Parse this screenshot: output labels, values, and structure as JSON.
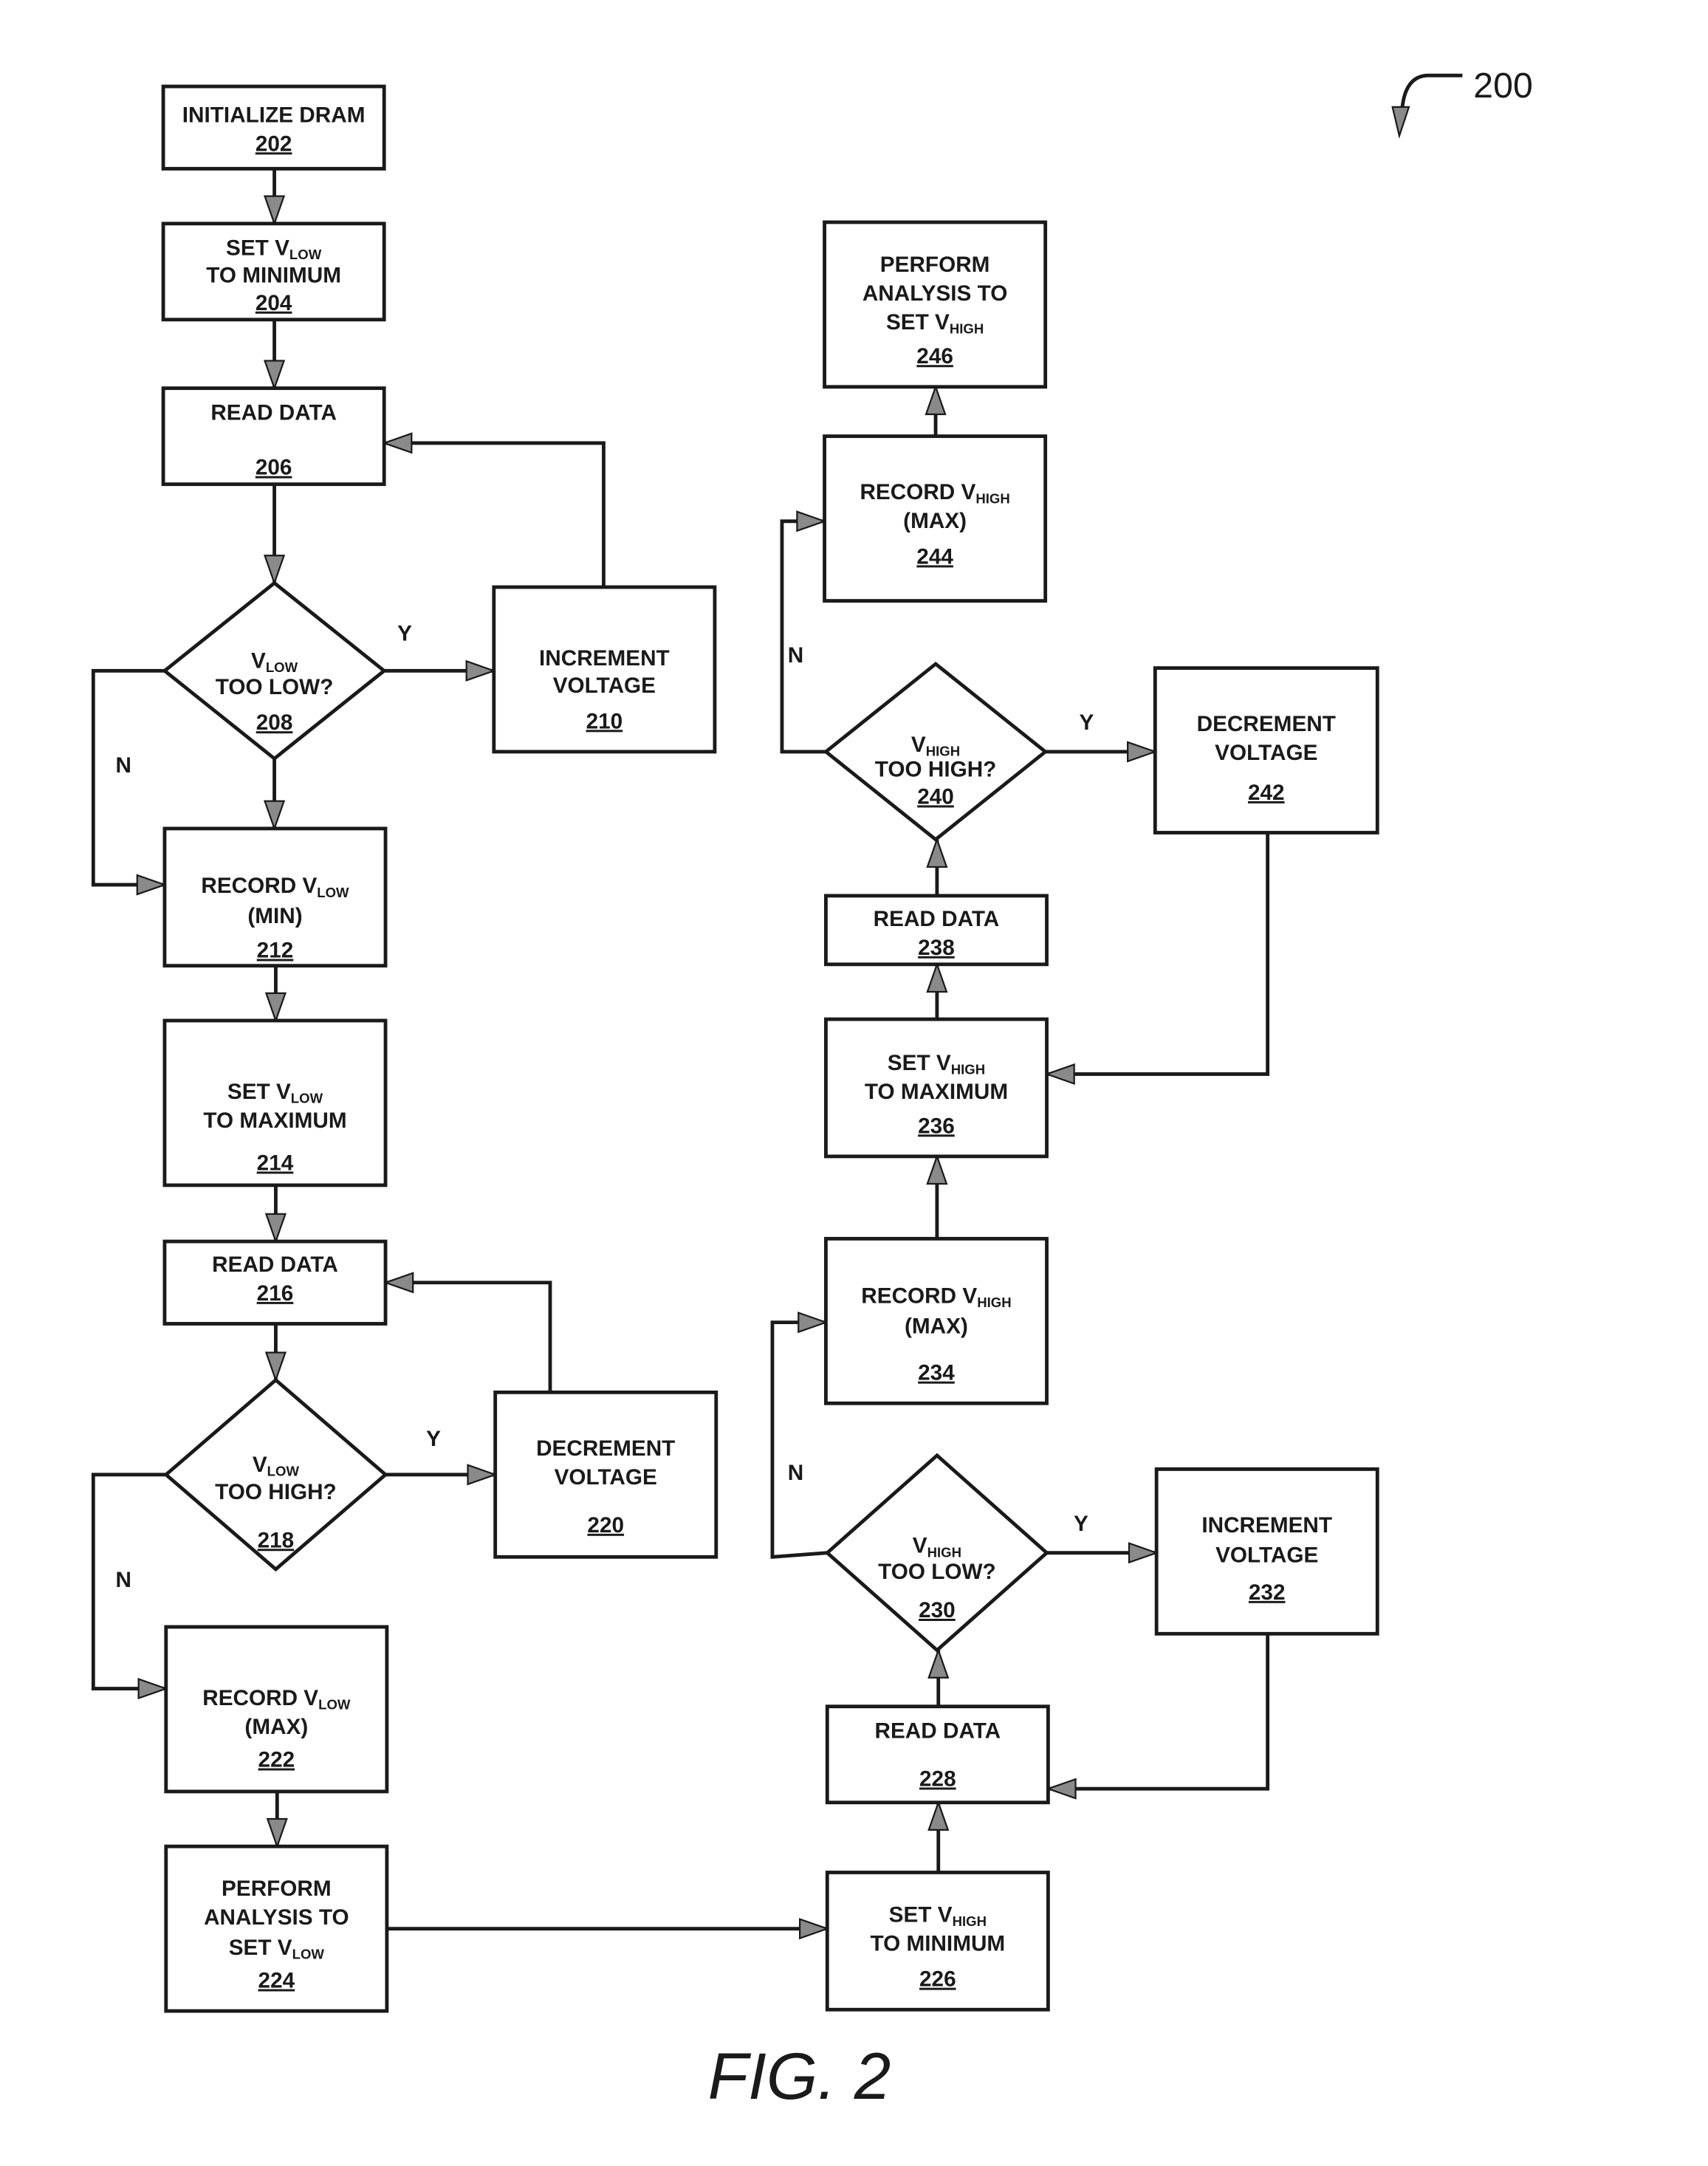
{
  "figure": {
    "caption": "FIG. 2",
    "reference_number": "200"
  },
  "nodes": [
    {
      "id": "202",
      "type": "process",
      "lines": [
        [
          "INITIALIZE DRAM",
          ""
        ]
      ]
    },
    {
      "id": "204",
      "type": "process",
      "lines": [
        [
          "SET V",
          "LOW"
        ],
        [
          "TO MINIMUM",
          ""
        ]
      ]
    },
    {
      "id": "206",
      "type": "process",
      "lines": [
        [
          "READ DATA",
          ""
        ]
      ]
    },
    {
      "id": "208",
      "type": "decision",
      "lines": [
        [
          "V",
          "LOW"
        ],
        [
          "TOO LOW?",
          ""
        ]
      ]
    },
    {
      "id": "210",
      "type": "process",
      "lines": [
        [
          "INCREMENT",
          ""
        ],
        [
          "VOLTAGE",
          ""
        ]
      ]
    },
    {
      "id": "212",
      "type": "process",
      "lines": [
        [
          "RECORD  V",
          "LOW"
        ],
        [
          "(MIN)",
          ""
        ]
      ]
    },
    {
      "id": "214",
      "type": "process",
      "lines": [
        [
          "SET V",
          "LOW"
        ],
        [
          "TO MAXIMUM",
          ""
        ]
      ]
    },
    {
      "id": "216",
      "type": "process",
      "lines": [
        [
          "READ DATA",
          ""
        ]
      ]
    },
    {
      "id": "218",
      "type": "decision",
      "lines": [
        [
          "V",
          "LOW"
        ],
        [
          "TOO HIGH?",
          ""
        ]
      ]
    },
    {
      "id": "220",
      "type": "process",
      "lines": [
        [
          "DECREMENT",
          ""
        ],
        [
          "VOLTAGE",
          ""
        ]
      ]
    },
    {
      "id": "222",
      "type": "process",
      "lines": [
        [
          "RECORD  V",
          "LOW"
        ],
        [
          "(MAX)",
          ""
        ]
      ]
    },
    {
      "id": "224",
      "type": "process",
      "lines": [
        [
          "PERFORM",
          ""
        ],
        [
          "ANALYSIS TO",
          ""
        ],
        [
          "SET  V",
          "LOW"
        ]
      ]
    },
    {
      "id": "226",
      "type": "process",
      "lines": [
        [
          "SET  V",
          "HIGH"
        ],
        [
          "TO MINIMUM",
          ""
        ]
      ]
    },
    {
      "id": "228",
      "type": "process",
      "lines": [
        [
          "READ DATA",
          ""
        ]
      ]
    },
    {
      "id": "230",
      "type": "decision",
      "lines": [
        [
          "V",
          "HIGH"
        ],
        [
          "TOO LOW?",
          ""
        ]
      ]
    },
    {
      "id": "232",
      "type": "process",
      "lines": [
        [
          "INCREMENT",
          ""
        ],
        [
          "VOLTAGE",
          ""
        ]
      ]
    },
    {
      "id": "234",
      "type": "process",
      "lines": [
        [
          "RECORD  V",
          "HIGH"
        ],
        [
          "(MAX)",
          ""
        ]
      ]
    },
    {
      "id": "236",
      "type": "process",
      "lines": [
        [
          "SET  V",
          "HIGH"
        ],
        [
          "TO MAXIMUM",
          ""
        ]
      ]
    },
    {
      "id": "238",
      "type": "process",
      "lines": [
        [
          "READ DATA",
          ""
        ]
      ]
    },
    {
      "id": "240",
      "type": "decision",
      "lines": [
        [
          "V",
          "HIGH"
        ],
        [
          "TOO HIGH?",
          ""
        ]
      ]
    },
    {
      "id": "242",
      "type": "process",
      "lines": [
        [
          "DECREMENT",
          ""
        ],
        [
          "VOLTAGE",
          ""
        ]
      ]
    },
    {
      "id": "244",
      "type": "process",
      "lines": [
        [
          "RECORD  V",
          "HIGH"
        ],
        [
          "(MAX)",
          ""
        ]
      ]
    },
    {
      "id": "246",
      "type": "process",
      "lines": [
        [
          "PERFORM",
          ""
        ],
        [
          "ANALYSIS TO",
          ""
        ],
        [
          "SET  V",
          "HIGH"
        ]
      ]
    }
  ],
  "edges": [
    {
      "from": "202",
      "to": "204",
      "label": ""
    },
    {
      "from": "204",
      "to": "206",
      "label": ""
    },
    {
      "from": "206",
      "to": "208",
      "label": ""
    },
    {
      "from": "208",
      "to": "210",
      "label": "Y"
    },
    {
      "from": "208",
      "to": "212",
      "label": "N"
    },
    {
      "from": "208",
      "to": "212",
      "label": ""
    },
    {
      "from": "210",
      "to": "206",
      "label": ""
    },
    {
      "from": "212",
      "to": "214",
      "label": ""
    },
    {
      "from": "214",
      "to": "216",
      "label": ""
    },
    {
      "from": "216",
      "to": "218",
      "label": ""
    },
    {
      "from": "218",
      "to": "220",
      "label": "Y"
    },
    {
      "from": "218",
      "to": "222",
      "label": "N"
    },
    {
      "from": "220",
      "to": "216",
      "label": ""
    },
    {
      "from": "222",
      "to": "224",
      "label": ""
    },
    {
      "from": "224",
      "to": "226",
      "label": ""
    },
    {
      "from": "226",
      "to": "228",
      "label": ""
    },
    {
      "from": "228",
      "to": "230",
      "label": ""
    },
    {
      "from": "230",
      "to": "232",
      "label": "Y"
    },
    {
      "from": "230",
      "to": "234",
      "label": "N"
    },
    {
      "from": "232",
      "to": "228",
      "label": ""
    },
    {
      "from": "234",
      "to": "236",
      "label": ""
    },
    {
      "from": "236",
      "to": "238",
      "label": ""
    },
    {
      "from": "238",
      "to": "240",
      "label": ""
    },
    {
      "from": "240",
      "to": "242",
      "label": "Y"
    },
    {
      "from": "240",
      "to": "244",
      "label": "N"
    },
    {
      "from": "242",
      "to": "236",
      "label": ""
    },
    {
      "from": "244",
      "to": "246",
      "label": ""
    }
  ]
}
